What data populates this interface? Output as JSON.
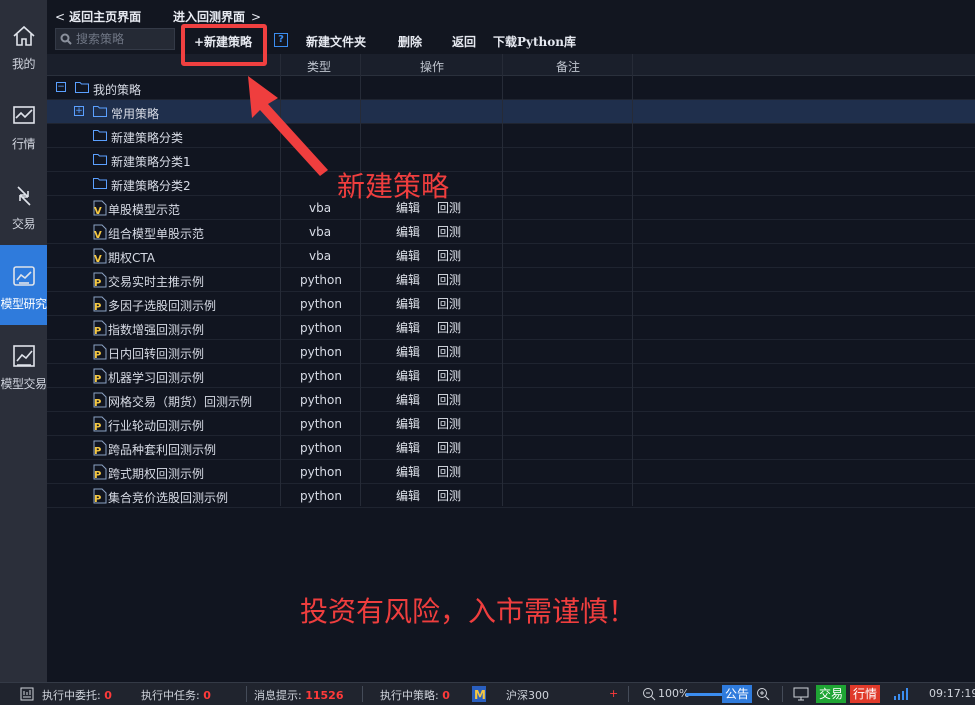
{
  "sidebar": {
    "items": [
      {
        "label": "我的",
        "icon": "home-icon"
      },
      {
        "label": "行情",
        "icon": "chart-icon"
      },
      {
        "label": "交易",
        "icon": "exchange-icon"
      },
      {
        "label": "模型研究",
        "icon": "model-research-icon",
        "active": true
      },
      {
        "label": "模型交易",
        "icon": "model-trade-icon"
      }
    ]
  },
  "header": {
    "back_home": "返回主页界面",
    "enter_backtest": "进入回测界面"
  },
  "search": {
    "placeholder": "搜索策略"
  },
  "toolbar": {
    "new_strategy": "+新建策略",
    "help": "?",
    "new_folder": "新建文件夹",
    "delete": "删除",
    "back": "返回",
    "download_python": "下载Python库"
  },
  "table": {
    "columns": {
      "type": "类型",
      "operation": "操作",
      "note": "备注"
    },
    "rows": [
      {
        "name": "我的策略",
        "kind": "folder",
        "toggle": "−",
        "type": "",
        "ops": false
      },
      {
        "name": "常用策略",
        "kind": "folder",
        "toggle": "+",
        "type": "",
        "ops": false,
        "selected": true
      },
      {
        "name": "新建策略分类",
        "kind": "folder",
        "type": "",
        "ops": false
      },
      {
        "name": "新建策略分类1",
        "kind": "folder",
        "type": "",
        "ops": false
      },
      {
        "name": "新建策略分类2",
        "kind": "folder",
        "type": "",
        "ops": false
      },
      {
        "name": "单股模型示范",
        "kind": "V",
        "type": "vba",
        "ops": true
      },
      {
        "name": "组合模型单股示范",
        "kind": "V",
        "type": "vba",
        "ops": true
      },
      {
        "name": "期权CTA",
        "kind": "V",
        "type": "vba",
        "ops": true
      },
      {
        "name": "交易实时主推示例",
        "kind": "P",
        "type": "python",
        "ops": true
      },
      {
        "name": "多因子选股回测示例",
        "kind": "P",
        "type": "python",
        "ops": true
      },
      {
        "name": "指数增强回测示例",
        "kind": "P",
        "type": "python",
        "ops": true
      },
      {
        "name": "日内回转回测示例",
        "kind": "P",
        "type": "python",
        "ops": true
      },
      {
        "name": "机器学习回测示例",
        "kind": "P",
        "type": "python",
        "ops": true
      },
      {
        "name": "网格交易（期货）回测示例",
        "kind": "P",
        "type": "python",
        "ops": true
      },
      {
        "name": "行业轮动回测示例",
        "kind": "P",
        "type": "python",
        "ops": true
      },
      {
        "name": "跨品种套利回测示例",
        "kind": "P",
        "type": "python",
        "ops": true
      },
      {
        "name": "跨式期权回测示例",
        "kind": "P",
        "type": "python",
        "ops": true
      },
      {
        "name": "集合竞价选股回测示例",
        "kind": "P",
        "type": "python",
        "ops": true
      }
    ],
    "op_edit": "编辑",
    "op_backtest": "回测"
  },
  "annotations": {
    "new_strategy": "新建策略",
    "risk": "投资有风险，入市需谨慎！"
  },
  "statusbar": {
    "entrust_label": "执行中委托:",
    "entrust_count": "0",
    "task_label": "执行中任务:",
    "task_count": "0",
    "msg_label": "消息提示:",
    "msg_count": "11526",
    "strategy_label": "执行中策略:",
    "strategy_count": "0",
    "index_name": "沪深300",
    "plus": "+",
    "zoom": "100%",
    "notice": "公告",
    "trade": "交易",
    "quote": "行情",
    "time": "09:17:19"
  },
  "colors": {
    "accent": "#2f7bdc",
    "annotation": "#ef3e3e",
    "trade_badge": "#1fa534",
    "quote_badge": "#e03a2a"
  }
}
